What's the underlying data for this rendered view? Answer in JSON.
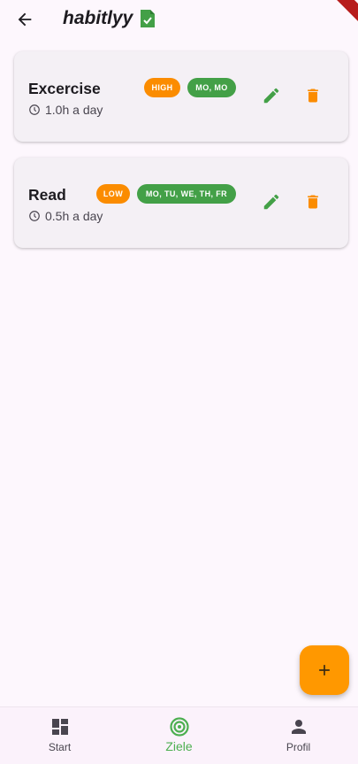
{
  "app": {
    "title": "habitlyy",
    "colors": {
      "accent_green": "#4caf50",
      "accent_orange": "#ff9800",
      "background": "#fdf7fd"
    }
  },
  "header": {
    "back_icon": "arrow-left-icon",
    "title_icon": "document-check-icon"
  },
  "habits": [
    {
      "name": "Excercise",
      "priority": "HIGH",
      "days": "MO, MO",
      "duration": "1.0h a day",
      "actions": {
        "edit": "edit-icon",
        "delete": "trash-icon"
      }
    },
    {
      "name": "Read",
      "priority": "LOW",
      "days": "MO, TU, WE, TH, FR",
      "duration": "0.5h a day",
      "actions": {
        "edit": "edit-icon",
        "delete": "trash-icon"
      }
    }
  ],
  "fab": {
    "icon": "plus-icon"
  },
  "bottom_nav": {
    "items": [
      {
        "label": "Start",
        "icon": "dashboard-icon",
        "active": false
      },
      {
        "label": "Ziele",
        "icon": "target-icon",
        "active": true
      },
      {
        "label": "Profil",
        "icon": "person-icon",
        "active": false
      }
    ]
  }
}
